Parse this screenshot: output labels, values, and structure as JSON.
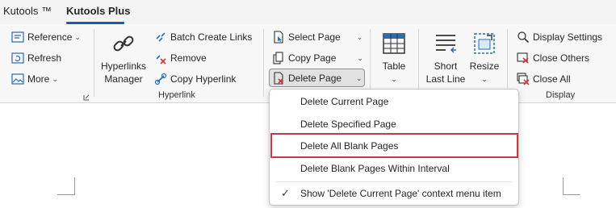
{
  "tabs": [
    {
      "label": "Kutools ™",
      "active": false
    },
    {
      "label": "Kutools Plus",
      "active": true
    }
  ],
  "ribbon": {
    "insert_group": {
      "reference": "Reference",
      "refresh": "Refresh",
      "more": "More"
    },
    "hyperlink_group": {
      "manager_line1": "Hyperlinks",
      "manager_line2": "Manager",
      "batch_create": "Batch Create Links",
      "remove": "Remove",
      "copy_hyperlink": "Copy Hyperlink",
      "group_label": "Hyperlink"
    },
    "page_group": {
      "select_page": "Select Page",
      "copy_page": "Copy Page",
      "delete_page": "Delete Page"
    },
    "table": {
      "label": "Table"
    },
    "short_last_line": {
      "line1": "Short",
      "line2": "Last Line"
    },
    "resize": {
      "label": "Resize"
    },
    "display_group": {
      "display_settings": "Display Settings",
      "close_others": "Close Others",
      "close_all": "Close All",
      "group_label": "Display"
    }
  },
  "dropdown_menu": {
    "items": [
      "Delete Current Page",
      "Delete Specified Page",
      "Delete All Blank Pages",
      "Delete Blank Pages Within Interval"
    ],
    "highlighted_index": 2,
    "toggle_item": "Show 'Delete Current Page' context menu item",
    "toggle_checked": true
  },
  "colors": {
    "accent_blue": "#185abd",
    "highlight_red": "#c43a4b",
    "icon_red": "#d13438",
    "icon_blue": "#2b6cb0"
  }
}
